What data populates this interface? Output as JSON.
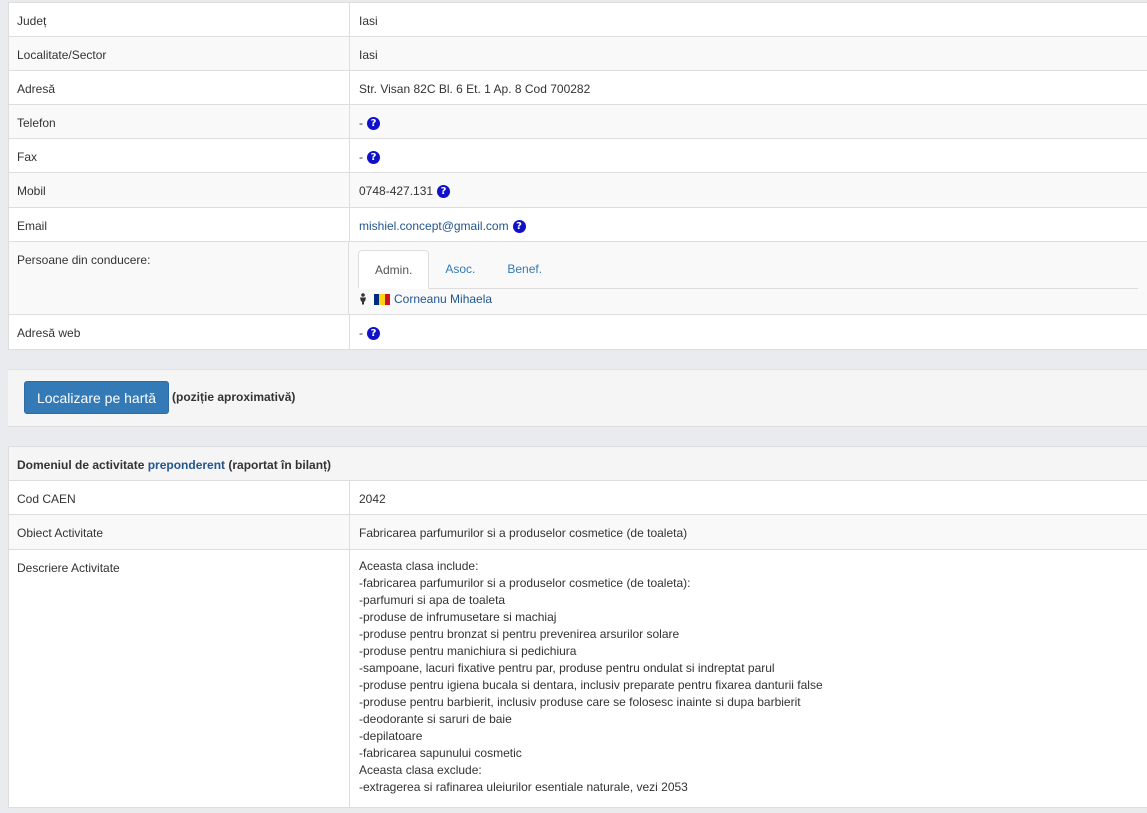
{
  "contact_rows": [
    {
      "label": "Județ",
      "value": "Iasi"
    },
    {
      "label": "Localitate/Sector",
      "value": "Iasi"
    },
    {
      "label": "Adresă",
      "value": "Str. Visan 82C Bl. 6 Et. 1 Ap. 8 Cod 700282"
    },
    {
      "label": "Telefon",
      "value": "-"
    },
    {
      "label": "Fax",
      "value": "-"
    },
    {
      "label": "Mobil",
      "value": "0748-427.131"
    },
    {
      "label": "Email",
      "value": "mishiel.concept@gmail.com"
    },
    {
      "label": "Persoane din conducere:"
    },
    {
      "label": "Adresă web",
      "value": "-"
    }
  ],
  "management": {
    "tabs": [
      "Admin.",
      "Asoc.",
      "Benef."
    ],
    "active_tab": "Admin.",
    "person": "Corneanu Mihaela",
    "flag_colors": [
      "#002b7f",
      "#fcd116",
      "#ce1126"
    ]
  },
  "map": {
    "button_label": "Localizare pe hartă",
    "note": "(poziție aproximativă)"
  },
  "activity": {
    "header_prefix": "Domeniul de activitate ",
    "header_link": "preponderent",
    "header_suffix": " (raportat în bilanț)",
    "caen_label": "Cod CAEN",
    "caen_value": "2042",
    "object_label": "Obiect Activitate",
    "object_value": "Fabricarea parfumurilor si a produselor cosmetice (de toaleta)",
    "desc_label": "Descriere Activitate",
    "desc_lines": [
      "Aceasta clasa include:",
      "-fabricarea parfumurilor si a produselor cosmetice (de toaleta):",
      "-parfumuri si apa de toaleta",
      "-produse de infrumusetare si machiaj",
      "-produse pentru bronzat si pentru prevenirea arsurilor solare",
      "-produse pentru manichiura si pedichiura",
      "-sampoane, lacuri fixative pentru par, produse pentru ondulat si indreptat parul",
      "-produse pentru igiena bucala si dentara, inclusiv preparate pentru fixarea danturii false",
      "-produse pentru barbierit, inclusiv produse care se folosesc inainte si dupa barbierit",
      "-deodorante si saruri de baie",
      "-depilatoare",
      "-fabricarea sapunului cosmetic",
      "Aceasta clasa exclude:",
      "-extragerea si rafinarea uleiurilor esentiale naturale, vezi 2053"
    ]
  },
  "icons": {
    "help": "question-circle-icon",
    "person": "person-icon",
    "flag": "romania-flag-icon"
  },
  "colors": {
    "accent": "#337ab7",
    "help_icon": "#1010c8",
    "link": "#23558f"
  }
}
